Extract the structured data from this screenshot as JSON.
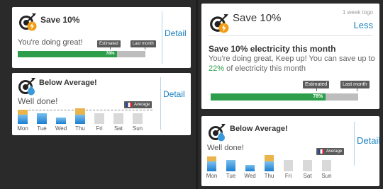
{
  "left": {
    "save_card": {
      "title": "Save 10%",
      "message": "You're doing great!",
      "detail_label": "Detail",
      "progress_percent_label": "78%",
      "progress_value": 78,
      "estimated_tag": "Estimated",
      "last_month_tag": "Last month"
    },
    "average_card": {
      "title": "Below Average!",
      "message": "Well done!",
      "detail_label": "Detail",
      "average_tag": "Average",
      "days": [
        "Mon",
        "Tue",
        "Wed",
        "Thu",
        "Fri",
        "Sat",
        "Sun"
      ]
    }
  },
  "right": {
    "save_card": {
      "title": "Save 10%",
      "timestamp": "1 week togo",
      "less_label": "Less",
      "heading": "Save 10% electricity this month",
      "body_prefix": "You're doing great, Keep up! You can save up to ",
      "body_percent": "22%",
      "body_suffix": " of electricity this month",
      "progress_percent_label": "78%",
      "progress_value": 78,
      "estimated_tag": "Estimated",
      "last_month_tag": "Last month"
    },
    "average_card": {
      "title": "Below Average!",
      "message": "Well done!",
      "detail_label": "Detail",
      "average_tag": "Average",
      "days": [
        "Mon",
        "Tue",
        "Wed",
        "Thu",
        "Fri",
        "Sat",
        "Sun"
      ]
    }
  },
  "colors": {
    "accent_blue": "#1a7fc1",
    "progress_green": "#2e9e4b",
    "highlight_green": "#2e9e4b",
    "bar_gold": "#e9b44c",
    "bar_blue": "#1b7fd0",
    "bar_grey": "#d9d9d9",
    "lightning_orange": "#f39c12",
    "water_blue": "#3a9ad9"
  },
  "icons": {
    "save_icon": "target-lightning-icon",
    "average_icon": "target-water-drop-icon",
    "flag_icon": "france-flag-icon"
  }
}
